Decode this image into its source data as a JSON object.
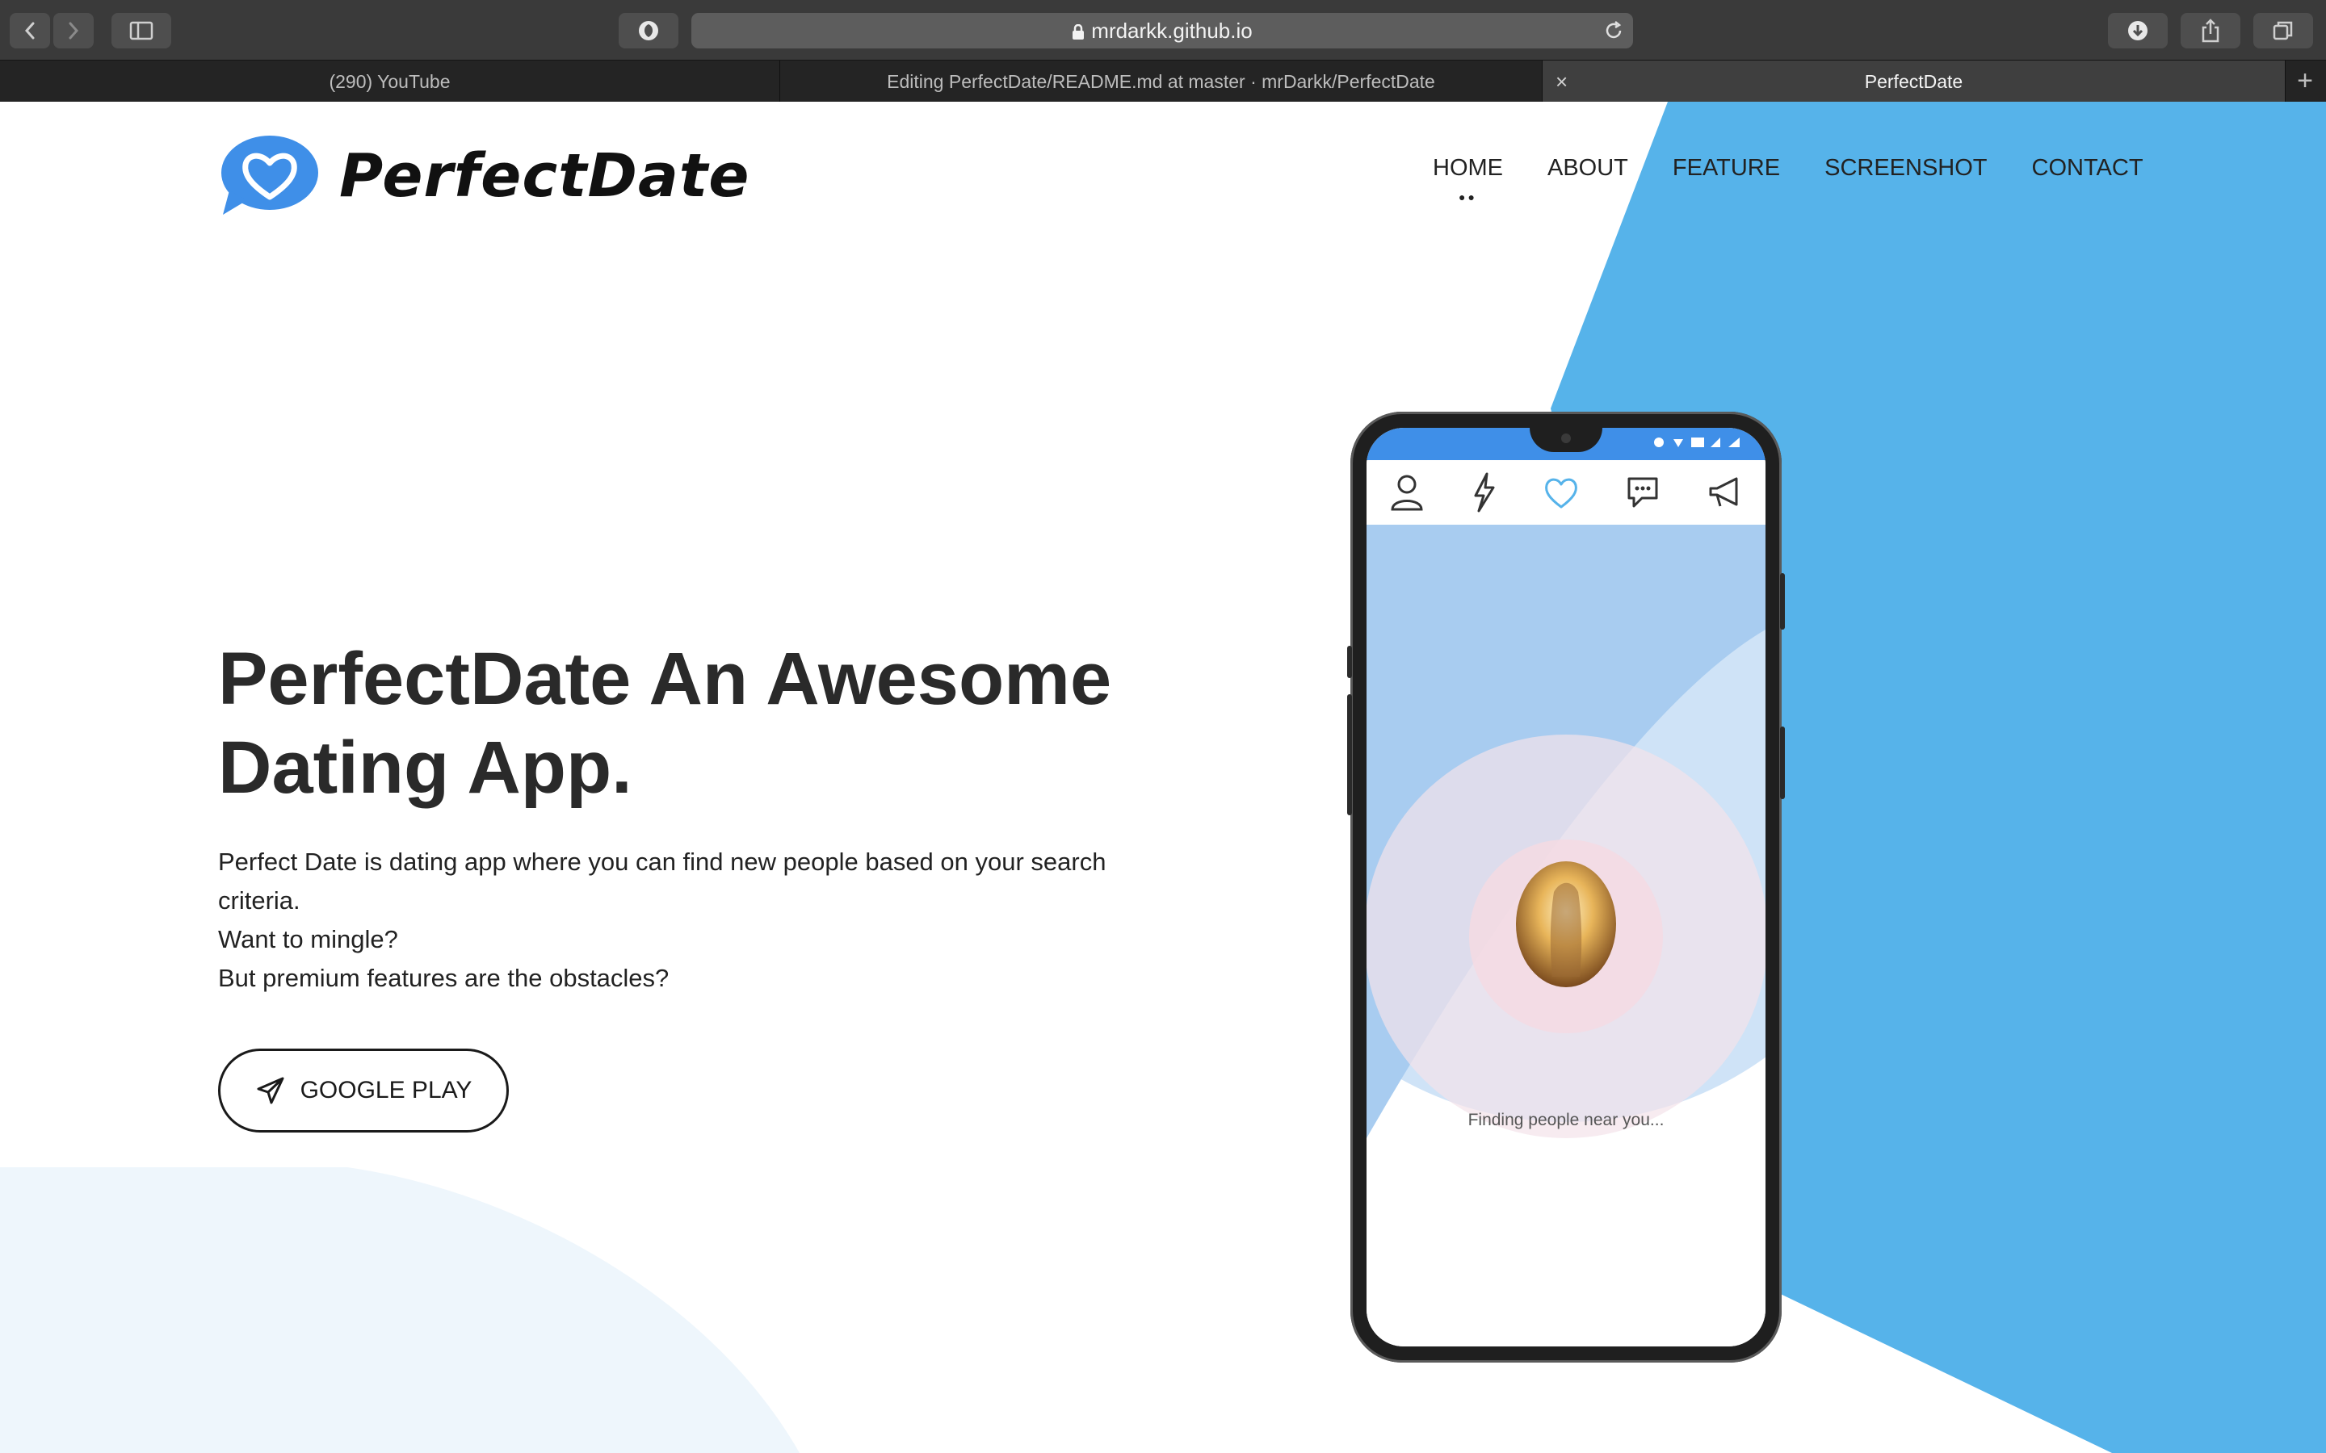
{
  "browser": {
    "url": "mrdarkk.github.io",
    "tabs": [
      {
        "label": "(290) YouTube"
      },
      {
        "label": "Editing PerfectDate/README.md at master · mrDarkk/PerfectDate"
      },
      {
        "label": "PerfectDate"
      }
    ],
    "close_glyph": "×",
    "new_tab_glyph": "+",
    "icons": [
      "back-icon",
      "forward-icon",
      "sidebar-icon",
      "privacy-shield-icon",
      "lock-icon",
      "reload-icon",
      "download-icon",
      "share-icon",
      "tabs-overview-icon"
    ]
  },
  "site": {
    "brand": "PerfectDate",
    "nav": [
      {
        "label": "HOME"
      },
      {
        "label": "ABOUT"
      },
      {
        "label": "FEATURE"
      },
      {
        "label": "SCREENSHOT"
      },
      {
        "label": "CONTACT"
      }
    ],
    "active_nav_marker": "●●",
    "hero": {
      "title": "PerfectDate An Awesome Dating App.",
      "description_lines": [
        "Perfect Date is dating app where you can find new people based on your search criteria.",
        "Want to mingle?",
        "But premium features are the obstacles?"
      ],
      "cta_label": "GOOGLE PLAY"
    },
    "phone": {
      "finding_text": "Finding people near you...",
      "app_tabs": [
        "profile-icon",
        "lightning-icon",
        "heart-icon",
        "chat-icon",
        "megaphone-icon"
      ],
      "active_app_tab": "heart-icon"
    }
  },
  "colors": {
    "accent_blue": "#56b3ea",
    "logo_blue": "#3f8fe8",
    "pale_blue": "#eef6fc",
    "text_dark": "#2a2a2a"
  }
}
